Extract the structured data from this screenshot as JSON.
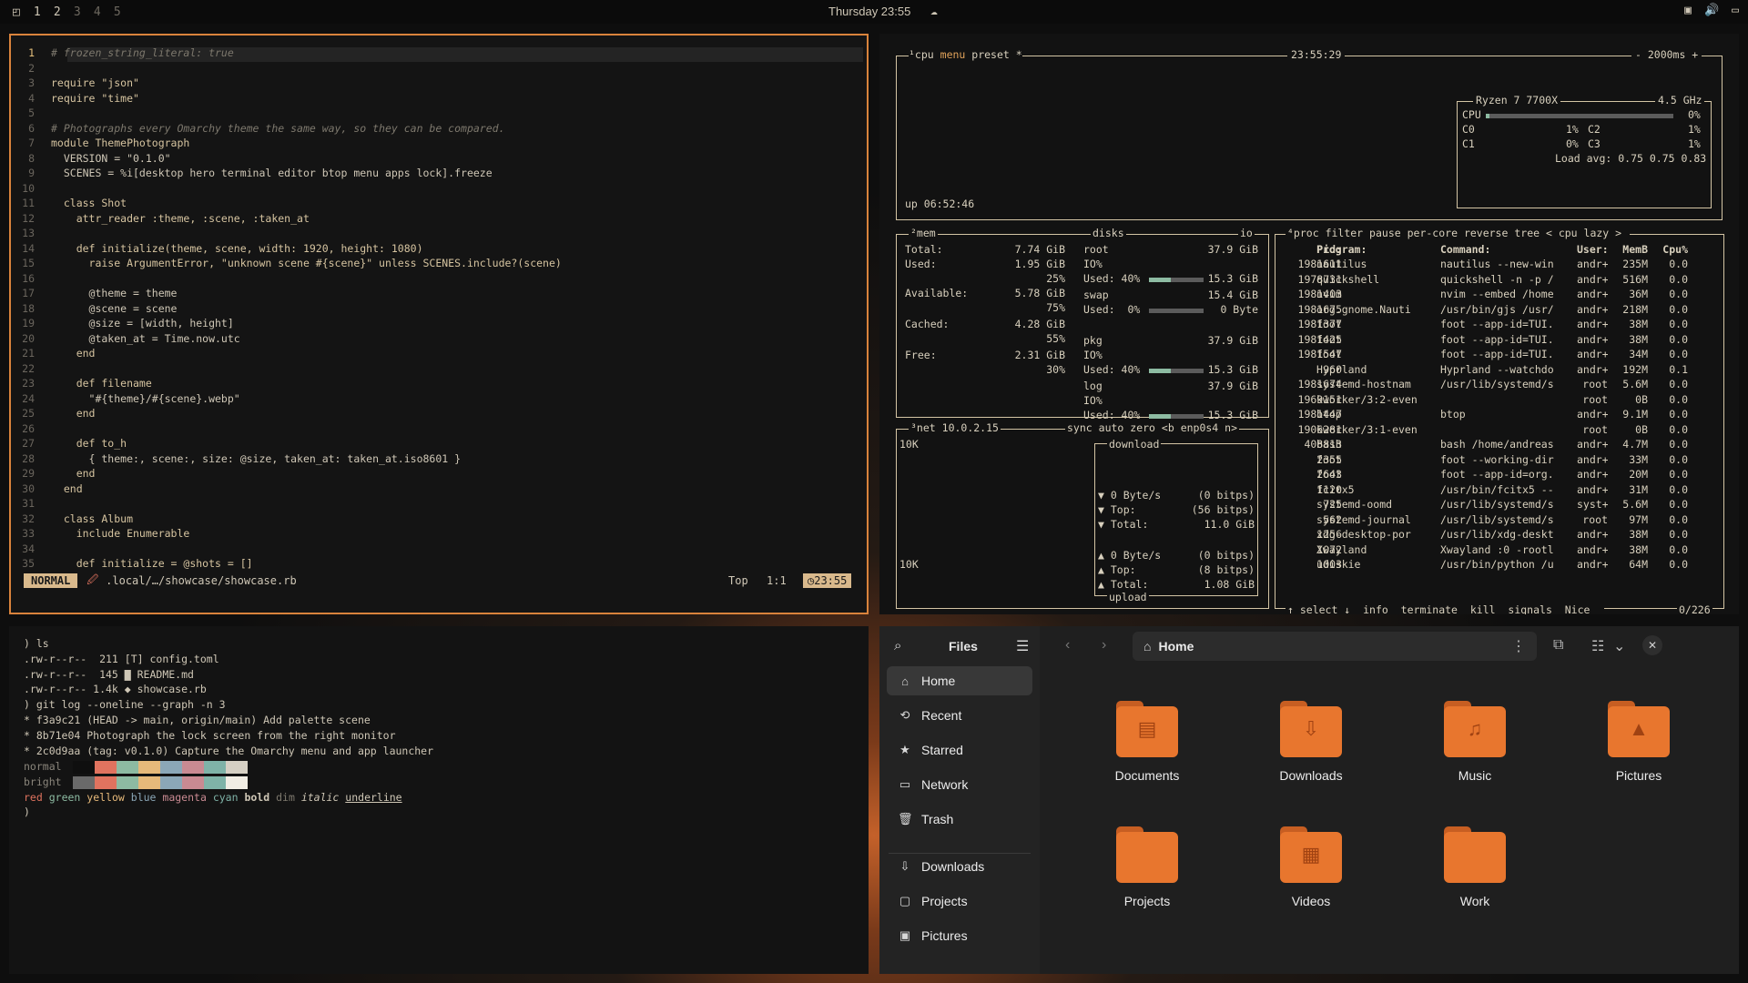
{
  "topbar": {
    "workspaces": [
      "1",
      "2",
      "3",
      "4",
      "5"
    ],
    "clock": "Thursday 23:55"
  },
  "nvim": {
    "lines": [
      {
        "n": "1",
        "t": "# frozen_string_literal: true"
      },
      {
        "n": "2",
        "t": ""
      },
      {
        "n": "3",
        "t": "require \"json\""
      },
      {
        "n": "4",
        "t": "require \"time\""
      },
      {
        "n": "5",
        "t": ""
      },
      {
        "n": "6",
        "t": "# Photographs every Omarchy theme the same way, so they can be compared."
      },
      {
        "n": "7",
        "t": "module ThemePhotograph"
      },
      {
        "n": "8",
        "t": "  VERSION = \"0.1.0\""
      },
      {
        "n": "9",
        "t": "  SCENES = %i[desktop hero terminal editor btop menu apps lock].freeze"
      },
      {
        "n": "10",
        "t": ""
      },
      {
        "n": "11",
        "t": "  class Shot"
      },
      {
        "n": "12",
        "t": "    attr_reader :theme, :scene, :taken_at"
      },
      {
        "n": "13",
        "t": ""
      },
      {
        "n": "14",
        "t": "    def initialize(theme, scene, width: 1920, height: 1080)"
      },
      {
        "n": "15",
        "t": "      raise ArgumentError, \"unknown scene #{scene}\" unless SCENES.include?(scene)"
      },
      {
        "n": "16",
        "t": ""
      },
      {
        "n": "17",
        "t": "      @theme = theme"
      },
      {
        "n": "18",
        "t": "      @scene = scene"
      },
      {
        "n": "19",
        "t": "      @size = [width, height]"
      },
      {
        "n": "20",
        "t": "      @taken_at = Time.now.utc"
      },
      {
        "n": "21",
        "t": "    end"
      },
      {
        "n": "22",
        "t": ""
      },
      {
        "n": "23",
        "t": "    def filename"
      },
      {
        "n": "24",
        "t": "      \"#{theme}/#{scene}.webp\""
      },
      {
        "n": "25",
        "t": "    end"
      },
      {
        "n": "26",
        "t": ""
      },
      {
        "n": "27",
        "t": "    def to_h"
      },
      {
        "n": "28",
        "t": "      { theme:, scene:, size: @size, taken_at: taken_at.iso8601 }"
      },
      {
        "n": "29",
        "t": "    end"
      },
      {
        "n": "30",
        "t": "  end"
      },
      {
        "n": "31",
        "t": ""
      },
      {
        "n": "32",
        "t": "  class Album"
      },
      {
        "n": "33",
        "t": "    include Enumerable"
      },
      {
        "n": "34",
        "t": ""
      },
      {
        "n": "35",
        "t": "    def initialize = @shots = []"
      }
    ],
    "status": {
      "mode": "NORMAL",
      "file": ".local/…/showcase/showcase.rb",
      "pos": "Top",
      "cursor": "1:1",
      "time": "23:55"
    }
  },
  "btop": {
    "cpu": {
      "tabs": [
        "¹cpu",
        "menu",
        "preset *"
      ],
      "time": "23:55:29",
      "interval": "- 2000ms +",
      "model": "Ryzen 7 7700X",
      "freq": "4.5 GHz",
      "uptime": "up 06:52:46",
      "rows": [
        {
          "label": "CPU",
          "pct": "0%",
          "v": 0.02
        },
        {
          "label": "C0",
          "pct": "1%",
          "v": 0.01
        },
        {
          "label": "C2",
          "pct": "1%",
          "v": 0.01
        },
        {
          "label": "C1",
          "pct": "0%",
          "v": 0
        },
        {
          "label": "C3",
          "pct": "1%",
          "v": 0.01
        }
      ],
      "load": "Load avg: 0.75 0.75 0.83"
    },
    "mem": {
      "title": "²mem",
      "rows": [
        {
          "k": "Total:",
          "v": "7.74 GiB"
        },
        {
          "k": "Used:",
          "v": "1.95 GiB"
        },
        {
          "k": "",
          "v": "25%"
        },
        {
          "k": "Available:",
          "v": "5.78 GiB"
        },
        {
          "k": "",
          "v": "75%"
        },
        {
          "k": "Cached:",
          "v": "4.28 GiB"
        },
        {
          "k": "",
          "v": "55%"
        },
        {
          "k": "Free:",
          "v": "2.31 GiB"
        },
        {
          "k": "",
          "v": "30%"
        }
      ]
    },
    "disks": {
      "title": "disks",
      "io": "io",
      "items": [
        {
          "name": "root",
          "size": "37.9 GiB",
          "io": "IO%",
          "used": "Used: 40%",
          "usedv": 0.4,
          "total": "15.3 GiB"
        },
        {
          "name": "swap",
          "size": "15.4 GiB",
          "io": "Used:  0%",
          "used": "",
          "usedv": 0,
          "total": "0 Byte"
        },
        {
          "name": "pkg",
          "size": "37.9 GiB",
          "io": "IO%",
          "used": "Used: 40%",
          "usedv": 0.4,
          "total": "15.3 GiB"
        },
        {
          "name": "log",
          "size": "37.9 GiB",
          "io": "IO%",
          "used": "Used: 40%",
          "usedv": 0.4,
          "total": "15.3 GiB"
        }
      ]
    },
    "net": {
      "title": "³net",
      "ip": "10.0.2.15",
      "opts": [
        "sync",
        "auto",
        "zero",
        "<b enp0s4 n>"
      ],
      "scale_top": "10K",
      "scale_bot": "10K",
      "download": [
        [
          "▼ 0 Byte/s",
          "(0 bitps)"
        ],
        [
          "▼ Top:",
          "(56 bitps)"
        ],
        [
          "▼ Total:",
          "11.0 GiB"
        ]
      ],
      "upload": [
        [
          "▲ 0 Byte/s",
          "(0 bitps)"
        ],
        [
          "▲ Top:",
          "(8 bitps)"
        ],
        [
          "▲ Total:",
          "1.08 GiB"
        ]
      ],
      "dl_label": "download",
      "ul_label": "upload"
    },
    "proc": {
      "tabs": [
        "⁴proc",
        "filter",
        "pause",
        "per-core",
        "reverse",
        "tree",
        "< cpu lazy >"
      ],
      "headers": [
        "Pid:",
        "Program:",
        "Command:",
        "User:",
        "MemB",
        "Cpu%"
      ],
      "rows": [
        [
          "1981611",
          "nautilus",
          "nautilus --new-win",
          "andr+",
          "235M",
          "0.0"
        ],
        [
          "1978731",
          "quickshell",
          "quickshell -n -p /",
          "andr+",
          "516M",
          "0.0"
        ],
        [
          "1981403",
          "nvim",
          "nvim --embed /home",
          "andr+",
          "36M",
          "0.0"
        ],
        [
          "1981675",
          "org.gnome.Nauti",
          "/usr/bin/gjs /usr/",
          "andr+",
          "218M",
          "0.0"
        ],
        [
          "1981377",
          "foot",
          "foot --app-id=TUI.",
          "andr+",
          "38M",
          "0.0"
        ],
        [
          "1981425",
          "foot",
          "foot --app-id=TUI.",
          "andr+",
          "38M",
          "0.0"
        ],
        [
          "1981547",
          "foot",
          "foot --app-id=TUI.",
          "andr+",
          "34M",
          "0.0"
        ],
        [
          "960",
          "Hyprland",
          "Hyprland --watchdo",
          "andr+",
          "192M",
          "0.1"
        ],
        [
          "1981674",
          "systemd-hostnam",
          "/usr/lib/systemd/s",
          "root",
          "5.6M",
          "0.0"
        ],
        [
          "1969151",
          "kworker/3:2-even",
          "",
          "root",
          "0B",
          "0.0"
        ],
        [
          "1981447",
          "btop",
          "btop",
          "andr+",
          "9.1M",
          "0.0"
        ],
        [
          "1906281",
          "kworker/3:1-even",
          "",
          "root",
          "0B",
          "0.0"
        ],
        [
          "408813",
          "bash",
          "bash /home/andreas",
          "andr+",
          "4.7M",
          "0.0"
        ],
        [
          "2355",
          "foot",
          "foot --working-dir",
          "andr+",
          "33M",
          "0.0"
        ],
        [
          "2643",
          "foot",
          "foot --app-id=org.",
          "andr+",
          "20M",
          "0.0"
        ],
        [
          "1120",
          "fcitx5",
          "/usr/bin/fcitx5 --",
          "andr+",
          "31M",
          "0.0"
        ],
        [
          "725",
          "systemd-oomd",
          "/usr/lib/systemd/s",
          "syst+",
          "5.6M",
          "0.0"
        ],
        [
          "562",
          "systemd-journal",
          "/usr/lib/systemd/s",
          "root",
          "97M",
          "0.0"
        ],
        [
          "1256",
          "xdg-desktop-por",
          "/usr/lib/xdg-deskt",
          "andr+",
          "38M",
          "0.0"
        ],
        [
          "1072",
          "Xwayland",
          "Xwayland :0 -rootl",
          "andr+",
          "38M",
          "0.0"
        ],
        [
          "1003",
          "udiskie",
          "/usr/bin/python /u",
          "andr+",
          "64M",
          "0.0"
        ]
      ],
      "footer": [
        "↑ select ↓",
        "info",
        "terminate",
        "kill",
        "signals",
        "Nice"
      ],
      "count": "0/226"
    }
  },
  "term": {
    "lines": [
      ") ls",
      ".rw-r--r--  211 [T] config.toml",
      ".rw-r--r--  145 ▇ README.md",
      ".rw-r--r-- 1.4k ◆ showcase.rb",
      ") git log --oneline --graph -n 3",
      "* f3a9c21 (HEAD -> main, origin/main) Add palette scene",
      "* 8b71e04 Photograph the lock screen from the right monitor",
      "* 2c0d9aa (tag: v0.1.0) Capture the Omarchy menu and app launcher"
    ],
    "normal_label": "normal",
    "bright_label": "bright",
    "normal_colors": [
      "#0f0f0f",
      "#e0735f",
      "#8dbba2",
      "#e6b97a",
      "#8ba7b7",
      "#c98a92",
      "#7fb3a8",
      "#d6d0c4"
    ],
    "bright_colors": [
      "#6a6a6a",
      "#e0735f",
      "#8dbba2",
      "#e6b97a",
      "#8ba7b7",
      "#c98a92",
      "#7fb3a8",
      "#f1ede4"
    ],
    "styles": [
      "red",
      "green",
      "yellow",
      "blue",
      "magenta",
      "cyan",
      "bold",
      "dim",
      "italic",
      "underline"
    ],
    "prompt": ")"
  },
  "files": {
    "title": "Files",
    "location": "Home",
    "sidebar": [
      {
        "icon": "⌂",
        "label": "Home"
      },
      {
        "icon": "⟲",
        "label": "Recent"
      },
      {
        "icon": "★",
        "label": "Starred"
      },
      {
        "icon": "▭",
        "label": "Network"
      },
      {
        "icon": "🗑",
        "label": "Trash"
      },
      {
        "icon": "⇩",
        "label": "Downloads"
      },
      {
        "icon": "▢",
        "label": "Projects"
      },
      {
        "icon": "▣",
        "label": "Pictures"
      }
    ],
    "folders": [
      {
        "name": "Documents",
        "glyph": "▤"
      },
      {
        "name": "Downloads",
        "glyph": "⇩"
      },
      {
        "name": "Music",
        "glyph": "♫"
      },
      {
        "name": "Pictures",
        "glyph": "▲"
      },
      {
        "name": "Projects",
        "glyph": ""
      },
      {
        "name": "Videos",
        "glyph": "▦"
      },
      {
        "name": "Work",
        "glyph": ""
      }
    ]
  }
}
